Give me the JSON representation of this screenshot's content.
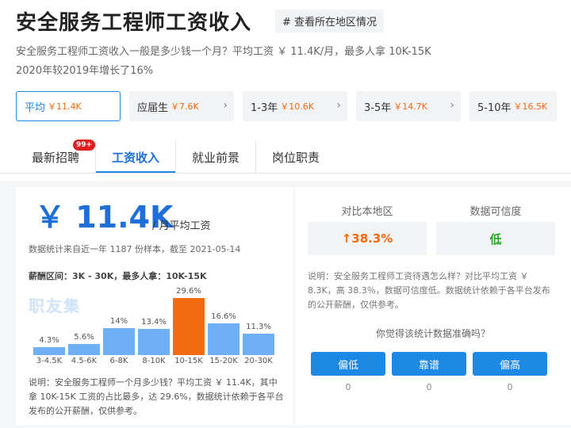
{
  "header": {
    "title": "安全服务工程师工资收入",
    "region_button": "# 查看所在地区情况"
  },
  "summary": {
    "line1": "安全服务工程师工资收入一般是多少钱一个月？平均工资 ￥ 11.4K/月，最多人拿 10K-15K",
    "line2": "2020年较2019年增长了16%"
  },
  "levels": [
    {
      "label": "平均",
      "amount": "￥11.4K"
    },
    {
      "label": "应届生",
      "amount": "￥7.6K"
    },
    {
      "label": "1-3年",
      "amount": "￥10.6K"
    },
    {
      "label": "3-5年",
      "amount": "￥14.7K"
    },
    {
      "label": "5-10年",
      "amount": "￥16.5K"
    }
  ],
  "tabs": [
    {
      "label": "最新招聘",
      "badge": "99+"
    },
    {
      "label": "工资收入"
    },
    {
      "label": "就业前景"
    },
    {
      "label": "岗位职责"
    }
  ],
  "salary": {
    "big": "￥ 11.4K",
    "unit": "/ 月平均工资",
    "note": "数据统计来自近一年 1187 份样本，截至 2021-05-14",
    "range": "薪酬区间：3K - 30K，最多人拿：10K-15K",
    "watermark": "职友集",
    "explain": "说明：安全服务工程师一个月多少钱？平均工资 ￥ 11.4K，其中拿 10K-15K 工资的占比最多，达 29.6%，数据统计依赖于各平台发布的公开薪酬，仅供参考。"
  },
  "chart_data": {
    "type": "bar",
    "categories": [
      "3-4.5K",
      "4.5-6K",
      "6-8K",
      "8-10K",
      "10-15K",
      "15-20K",
      "20-30K"
    ],
    "values": [
      4.3,
      5.6,
      14,
      13.4,
      29.6,
      16.6,
      11.3
    ],
    "labels": [
      "4.3%",
      "5.6%",
      "14%",
      "13.4%",
      "29.6%",
      "16.6%",
      "11.3%"
    ],
    "highlight_index": 4,
    "colors": {
      "bar": "#6fb0f5",
      "highlight": "#f26b10"
    }
  },
  "compare": {
    "local_head": "对比本地区",
    "local_value": "↑38.3%",
    "trust_head": "数据可信度",
    "trust_value": "低",
    "explain": "说明：安全服务工程师工资待遇怎么样？对比平均工资 ￥ 8.3K，高 38.3％，数据可信度低。数据统计依赖于各平台发布的公开薪酬，仅供参考。",
    "question": "你觉得该统计数据准确吗？",
    "votes": [
      {
        "label": "偏低",
        "count": "0"
      },
      {
        "label": "靠谱",
        "count": "0"
      },
      {
        "label": "偏高",
        "count": "0"
      }
    ]
  }
}
